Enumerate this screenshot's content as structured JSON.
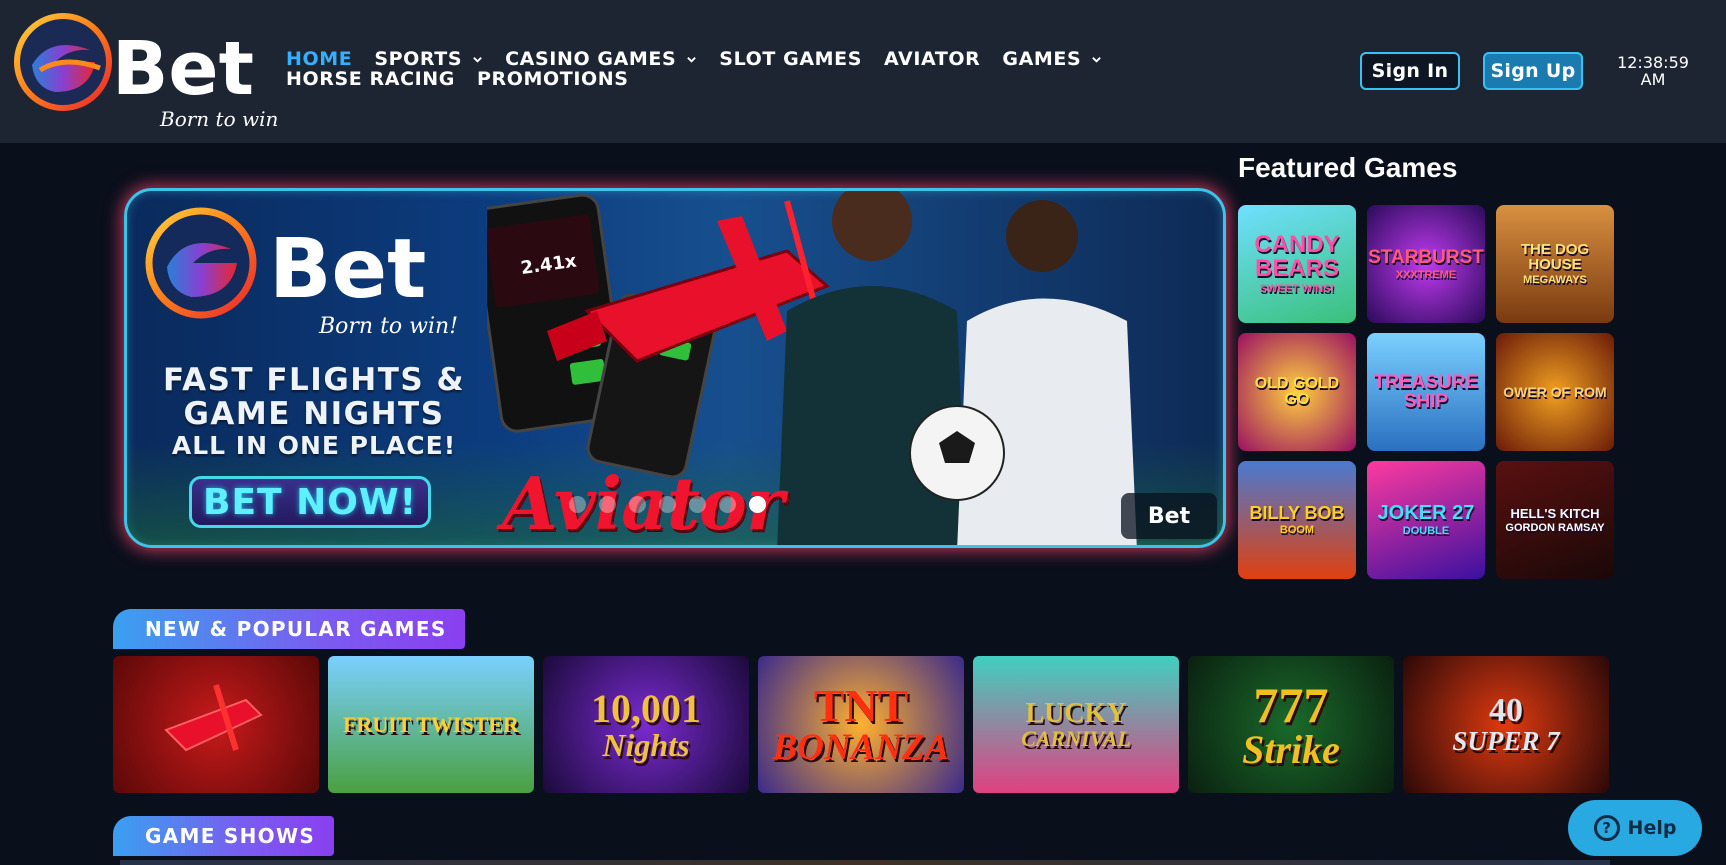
{
  "brand": {
    "name": "Bet",
    "tagline": "Born to win!"
  },
  "nav": {
    "row1": [
      {
        "label": "HOME",
        "active": true,
        "dropdown": false
      },
      {
        "label": "SPORTS",
        "active": false,
        "dropdown": true
      },
      {
        "label": "CASINO GAMES",
        "active": false,
        "dropdown": true
      },
      {
        "label": "SLOT GAMES",
        "active": false,
        "dropdown": false
      },
      {
        "label": "AVIATOR",
        "active": false,
        "dropdown": false
      },
      {
        "label": "GAMES",
        "active": false,
        "dropdown": true
      }
    ],
    "row2": [
      {
        "label": "HORSE RACING"
      },
      {
        "label": "PROMOTIONS"
      }
    ]
  },
  "auth": {
    "sign_in": "Sign In",
    "sign_up": "Sign Up"
  },
  "clock": {
    "time": "12:38:59",
    "ampm": "AM"
  },
  "hero": {
    "brand": "Bet",
    "tagline": "Born to win!",
    "line1": "FAST FLIGHTS &",
    "line2": "GAME NIGHTS",
    "line3": "ALL IN ONE PLACE!",
    "cta": "BET NOW!",
    "game_title": "Aviator",
    "multiplier": "2.41x",
    "slide_count": 7,
    "active_slide": 6
  },
  "featured": {
    "title": "Featured Games",
    "games": [
      {
        "name": "CANDY BEARS",
        "sub": "SWEET WINS!"
      },
      {
        "name": "STARBURST",
        "sub": "XXXTREME"
      },
      {
        "name": "THE DOG HOUSE",
        "sub": "MEGAWAYS"
      },
      {
        "name": "OLD GOLD GO",
        "sub": ""
      },
      {
        "name": "TREASURE SHIP",
        "sub": ""
      },
      {
        "name": "OWER OF ROM",
        "sub": ""
      },
      {
        "name": "BILLY BOB",
        "sub": "BOOM"
      },
      {
        "name": "JOKER 27",
        "sub": "DOUBLE"
      },
      {
        "name": "HELL'S KITCH",
        "sub": "GORDON RAMSAY"
      }
    ]
  },
  "sections": {
    "new_popular": "NEW & POPULAR GAMES",
    "game_shows": "GAME SHOWS"
  },
  "new_games": [
    {
      "name": "",
      "sub": ""
    },
    {
      "name": "FRUIT TWISTER",
      "sub": ""
    },
    {
      "name": "10,001",
      "sub": "Nights"
    },
    {
      "name": "TNT",
      "sub": "BONANZA"
    },
    {
      "name": "LUCKY",
      "sub": "CARNIVAL"
    },
    {
      "name": "777",
      "sub": "Strike"
    },
    {
      "name": "40",
      "sub": "SUPER 7"
    }
  ],
  "help": {
    "label": "Help"
  },
  "colors": {
    "header_bg": "#1d2533",
    "page_bg": "#0a0f1c",
    "accent_blue": "#33b0ff",
    "hero_border": "#3cc4e8",
    "help_bg": "#29a9e1"
  }
}
